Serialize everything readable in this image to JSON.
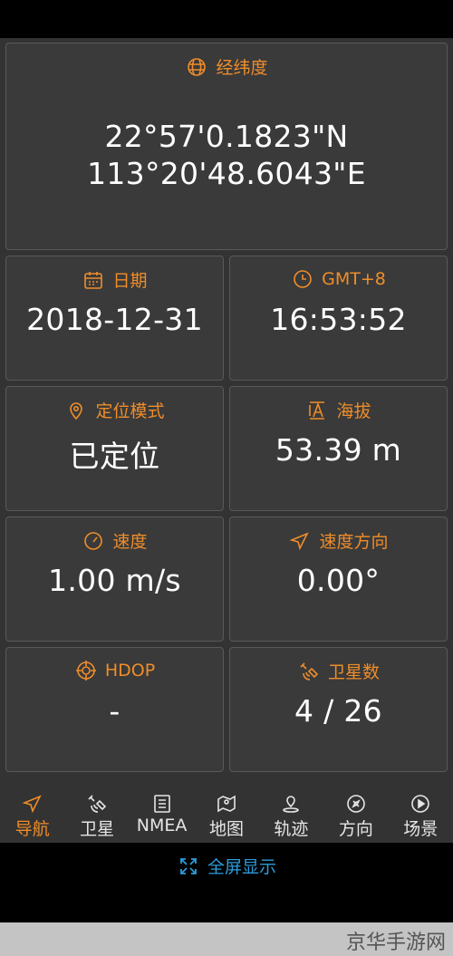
{
  "colors": {
    "accent": "#ef8d2a",
    "link": "#2d9cdb",
    "card_bg": "#3a3a3a"
  },
  "latlon": {
    "label": "经纬度",
    "icon": "globe-icon",
    "lat": "22°57'0.1823\"N",
    "lon": "113°20'48.6043\"E"
  },
  "cards": [
    {
      "label": "日期",
      "icon": "calendar-icon",
      "value": "2018-12-31"
    },
    {
      "label": "GMT+8",
      "icon": "clock-icon",
      "value": "16:53:52"
    },
    {
      "label": "定位模式",
      "icon": "location-pin-icon",
      "value": "已定位"
    },
    {
      "label": "海拔",
      "icon": "altitude-icon",
      "value": "53.39 m"
    },
    {
      "label": "速度",
      "icon": "speedometer-icon",
      "value": "1.00 m/s"
    },
    {
      "label": "速度方向",
      "icon": "direction-arrow-icon",
      "value": "0.00°"
    },
    {
      "label": "HDOP",
      "icon": "crosshair-icon",
      "value": "-"
    },
    {
      "label": "卫星数",
      "icon": "satellite-icon",
      "value": "4 / 26"
    }
  ],
  "nav": [
    {
      "label": "导航",
      "icon": "navigation-icon",
      "active": true
    },
    {
      "label": "卫星",
      "icon": "satellite-icon"
    },
    {
      "label": "NMEA",
      "icon": "document-icon"
    },
    {
      "label": "地图",
      "icon": "map-icon"
    },
    {
      "label": "轨迹",
      "icon": "track-icon"
    },
    {
      "label": "方向",
      "icon": "compass-icon"
    },
    {
      "label": "场景",
      "icon": "play-icon"
    }
  ],
  "fullscreen": {
    "label": "全屏显示",
    "icon": "fullscreen-icon"
  },
  "watermark": "京华手游网"
}
